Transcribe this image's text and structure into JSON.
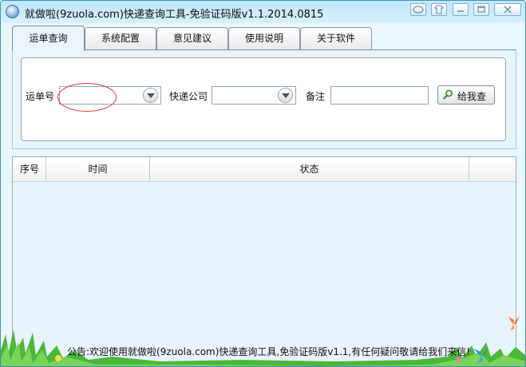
{
  "window": {
    "title": "就做啦(9zuola.com)快递查询工具-免验证码版v1.1.2014.0815"
  },
  "tabs": [
    {
      "label": "运单查询",
      "active": true
    },
    {
      "label": "系统配置",
      "active": false
    },
    {
      "label": "意见建议",
      "active": false
    },
    {
      "label": "使用说明",
      "active": false
    },
    {
      "label": "关于软件",
      "active": false
    }
  ],
  "query": {
    "waybill_label": "运单号",
    "waybill_value": "",
    "company_label": "快递公司",
    "company_value": "",
    "remark_label": "备注",
    "remark_value": "",
    "search_button": "给我查"
  },
  "results_table": {
    "columns": [
      "序号",
      "时间",
      "状态"
    ],
    "rows": []
  },
  "notice": "公告:欢迎使用就做啦(9zuola.com)快递查询工具,免验证码版v1.1,有任何疑问敬请给我们来信!",
  "colors": {
    "accent": "#3f8fb9",
    "annotation_circle": "#e53030",
    "background": "#e9f7ff"
  },
  "icons": {
    "app": "app-globe-icon",
    "search": "magnifier-icon",
    "combo_arrow": "chevron-down-icon",
    "titlebar": [
      "chat-icon",
      "skin-icon",
      "minimize-icon",
      "maximize-icon",
      "close-icon"
    ]
  }
}
